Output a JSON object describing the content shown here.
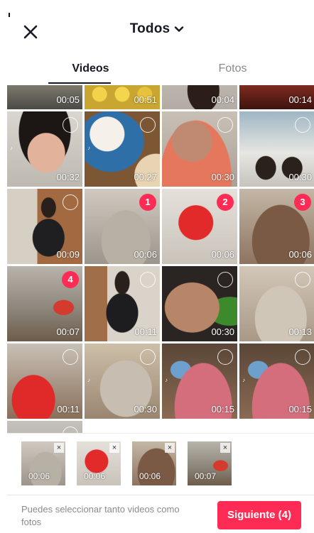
{
  "header": {
    "title": "Todos"
  },
  "tabs": [
    {
      "label": "Videos",
      "active": true
    },
    {
      "label": "Fotos",
      "active": false
    }
  ],
  "grid": {
    "items": [
      {
        "duration": "00:05",
        "selected_order": null
      },
      {
        "duration": "00:51",
        "selected_order": null
      },
      {
        "duration": "00:04",
        "selected_order": null
      },
      {
        "duration": "00:14",
        "selected_order": null
      },
      {
        "duration": "00:32",
        "selected_order": null
      },
      {
        "duration": "00:27",
        "selected_order": null
      },
      {
        "duration": "00:30",
        "selected_order": null
      },
      {
        "duration": "00:30",
        "selected_order": null
      },
      {
        "duration": "00:09",
        "selected_order": null
      },
      {
        "duration": "00:06",
        "selected_order": "1"
      },
      {
        "duration": "00:06",
        "selected_order": "2"
      },
      {
        "duration": "00:06",
        "selected_order": "3"
      },
      {
        "duration": "00:07",
        "selected_order": "4"
      },
      {
        "duration": "00:11",
        "selected_order": null
      },
      {
        "duration": "00:30",
        "selected_order": null
      },
      {
        "duration": "00:13",
        "selected_order": null
      },
      {
        "duration": "00:11",
        "selected_order": null
      },
      {
        "duration": "00:30",
        "selected_order": null
      },
      {
        "duration": "00:15",
        "selected_order": null
      },
      {
        "duration": "00:15",
        "selected_order": null
      },
      {
        "duration": "",
        "selected_order": null
      }
    ]
  },
  "selected_tray": {
    "items": [
      {
        "duration": "00:06"
      },
      {
        "duration": "00:06"
      },
      {
        "duration": "00:06"
      },
      {
        "duration": "00:07"
      }
    ],
    "remove_glyph": "×"
  },
  "footer": {
    "hint": "Puedes seleccionar tanto videos como fotos",
    "next_label": "Siguiente (4)"
  },
  "colors": {
    "accent": "#fe2c55",
    "text": "#161823",
    "muted": "#8a8b91"
  },
  "icons": {
    "close": "close-icon",
    "title_dropdown": "chevron-down-icon",
    "selection": "selection-circle-icon"
  }
}
